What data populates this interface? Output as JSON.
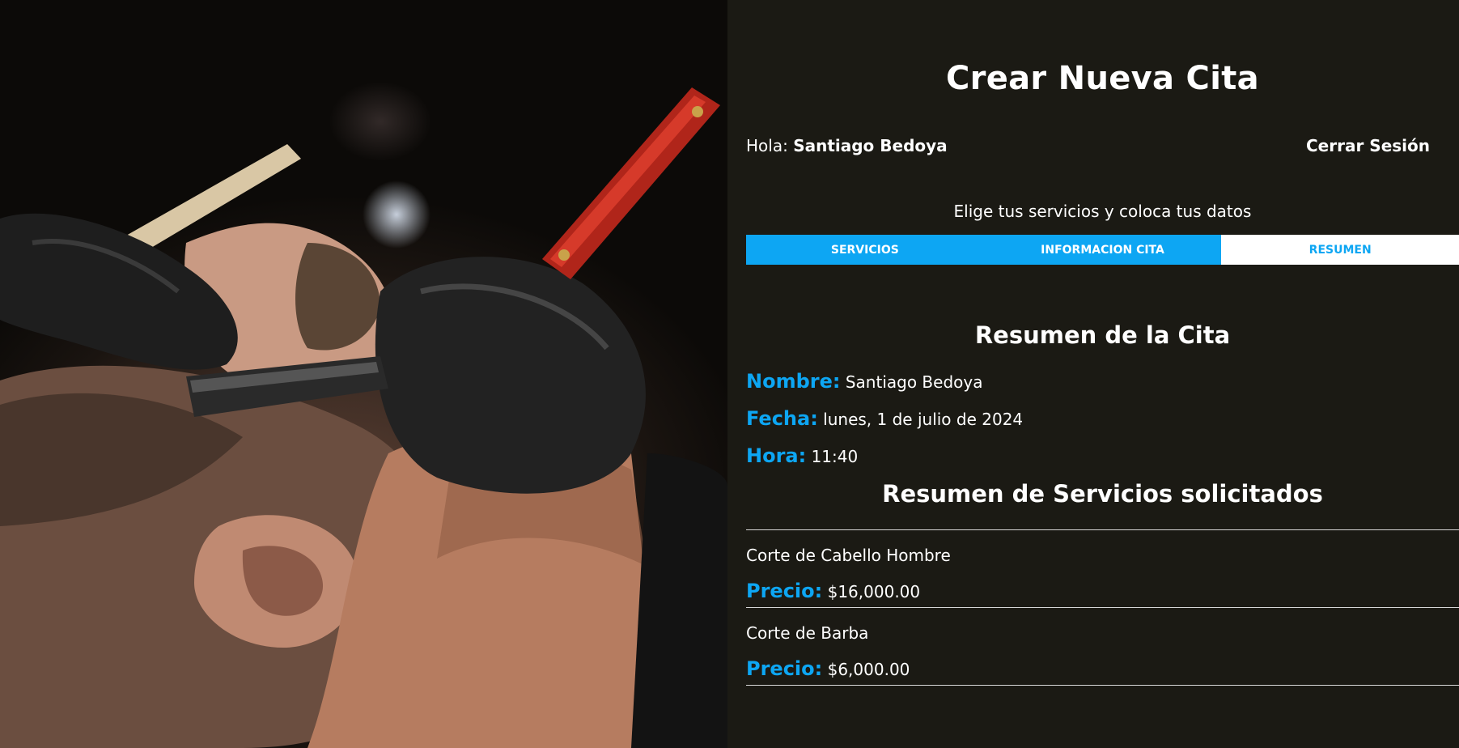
{
  "header": {
    "title": "Crear Nueva Cita",
    "greeting_prefix": "Hola:",
    "user_name": "Santiago Bedoya",
    "logout_label": "Cerrar Sesión"
  },
  "subtitle": "Elige tus servicios y coloca tus datos",
  "tabs": [
    {
      "label": "Servicios",
      "active": false
    },
    {
      "label": "Informacion Cita",
      "active": false
    },
    {
      "label": "Resumen",
      "active": true
    }
  ],
  "summary": {
    "title": "Resumen de la Cita",
    "nombre_label": "Nombre:",
    "nombre_value": "Santiago Bedoya",
    "fecha_label": "Fecha:",
    "fecha_value": "lunes, 1 de julio de 2024",
    "hora_label": "Hora:",
    "hora_value": "11:40"
  },
  "services": {
    "title": "Resumen de Servicios solicitados",
    "items": [
      {
        "name": "Corte de Cabello Hombre",
        "price_label": "Precio:",
        "price": "$16,000.00"
      },
      {
        "name": "Corte de Barba",
        "price_label": "Precio:",
        "price": "$6,000.00"
      }
    ]
  },
  "colors": {
    "background": "#1b1a14",
    "accent": "#0da6f3",
    "text": "#ffffff"
  }
}
